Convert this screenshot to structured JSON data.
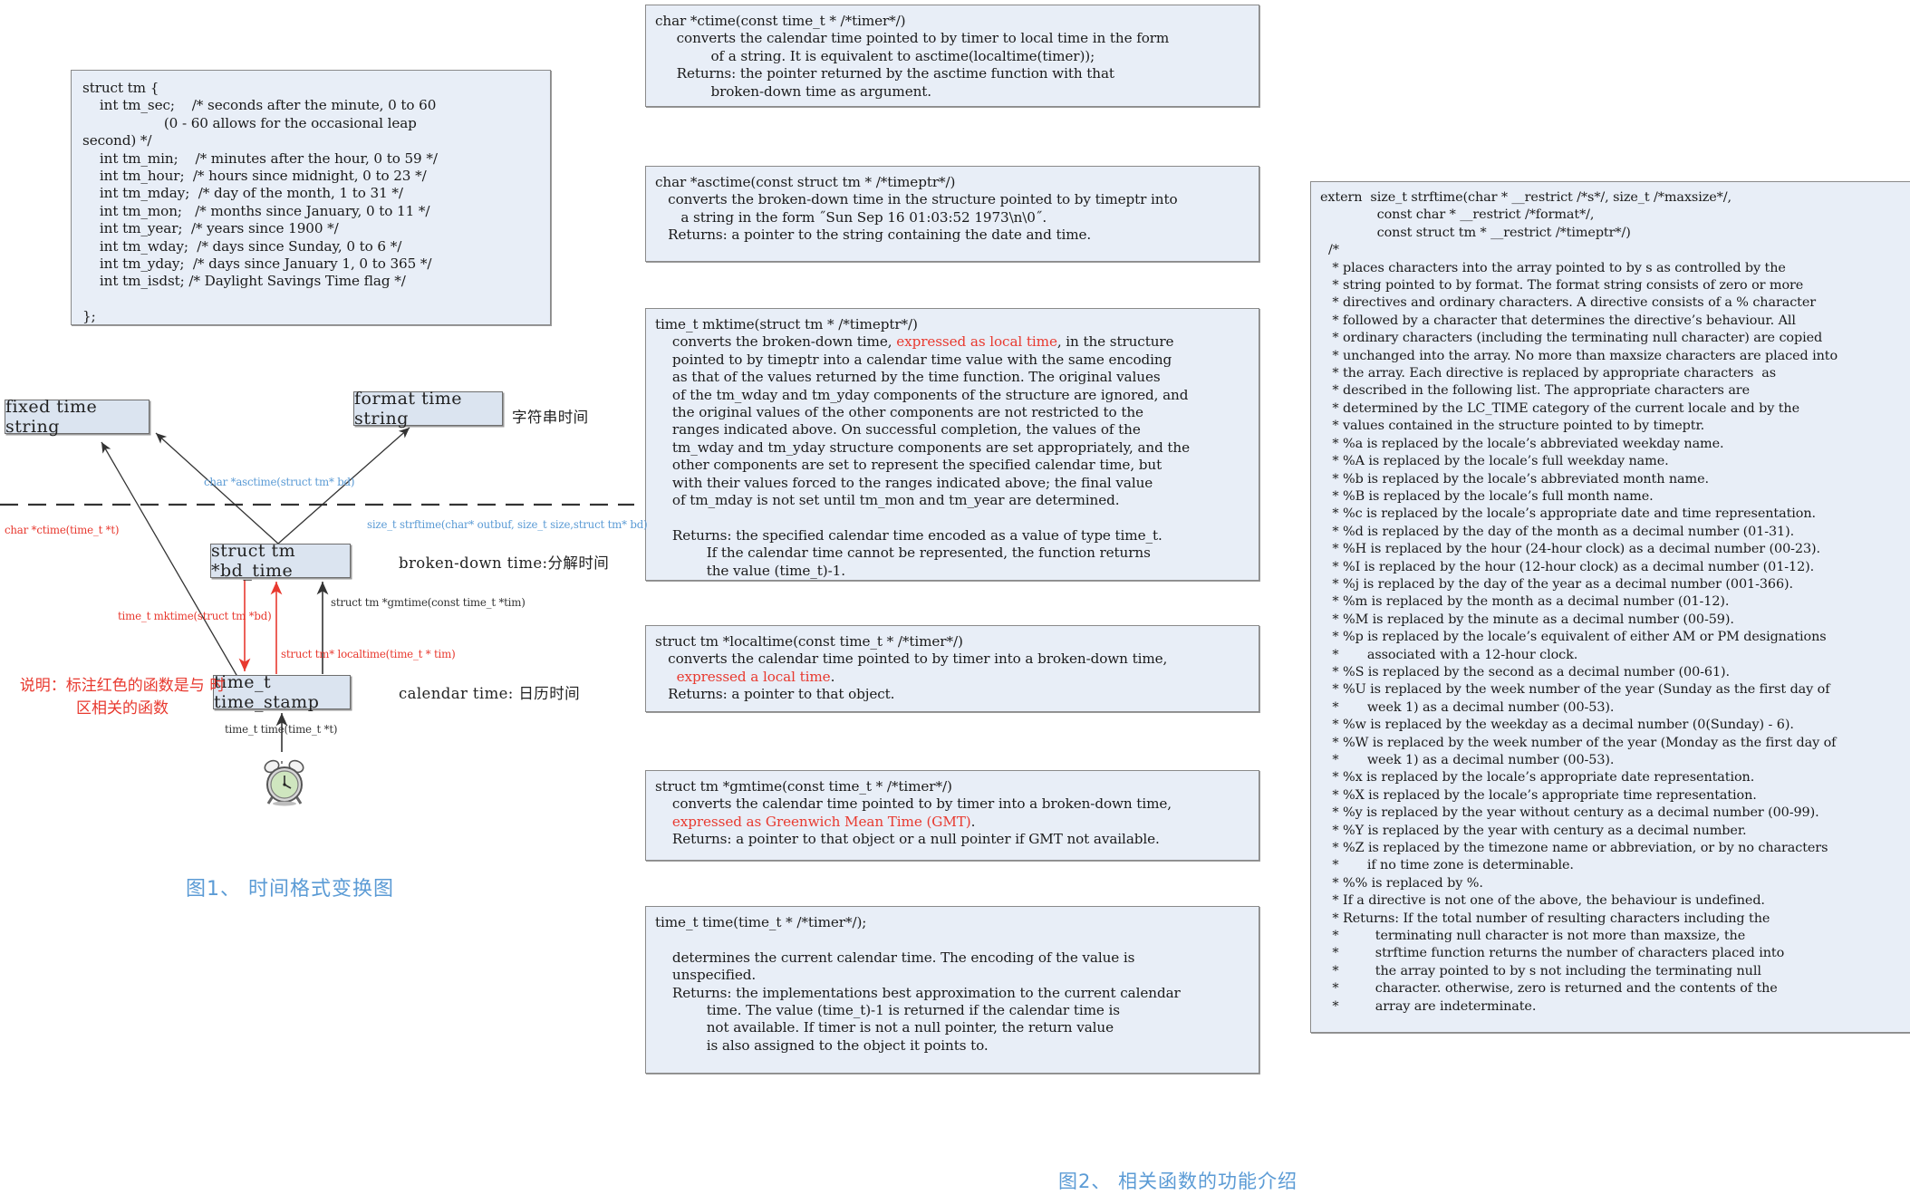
{
  "struct_box": {
    "code": "struct tm {\n    int tm_sec;    /* seconds after the minute, 0 to 60\n                   (0 - 60 allows for the occasional leap\nsecond) */\n    int tm_min;    /* minutes after the hour, 0 to 59 */\n    int tm_hour;  /* hours since midnight, 0 to 23 */\n    int tm_mday;  /* day of the month, 1 to 31 */\n    int tm_mon;   /* months since January, 0 to 11 */\n    int tm_year;  /* years since 1900 */\n    int tm_wday;  /* days since Sunday, 0 to 6 */\n    int tm_yday;  /* days since January 1, 0 to 365 */\n    int tm_isdst; /* Daylight Savings Time flag */\n\n};"
  },
  "middle_column": {
    "ctime": {
      "pre": "char *ctime(const time_t * /*timer*/)\n     converts the calendar time pointed to by timer to local time in the form\n             of a string. It is equivalent to asctime(localtime(timer));\n     Returns: the pointer returned by the asctime function with that\n             broken-down time as argument."
    },
    "asctime": {
      "pre": "char *asctime(const struct tm * /*timeptr*/)\n   converts the broken-down time in the structure pointed to by timeptr into\n      a string in the form ˝Sun Sep 16 01:03:52 1973\\n\\0˝.\n   Returns: a pointer to the string containing the date and time."
    },
    "mktime": {
      "line1": "time_t mktime(struct tm * /*timeptr*/)",
      "line2a": "    converts the broken-down time, ",
      "line2_red": "expressed as local time",
      "line2b": ", in the structure",
      "rest": "    pointed to by timeptr into a calendar time value with the same encoding\n    as that of the values returned by the time function. The original values\n    of the tm_wday and tm_yday components of the structure are ignored, and\n    the original values of the other components are not restricted to the\n    ranges indicated above. On successful completion, the values of the\n    tm_wday and tm_yday structure components are set appropriately, and the\n    other components are set to represent the specified calendar time, but\n    with their values forced to the ranges indicated above; the final value\n    of tm_mday is not set until tm_mon and tm_year are determined.\n\n    Returns: the specified calendar time encoded as a value of type time_t.\n            If the calendar time cannot be represented, the function returns\n            the value (time_t)-1."
    },
    "localtime": {
      "line1": "struct tm *localtime(const time_t * /*timer*/)",
      "line2": "   converts the calendar time pointed to by timer into a broken-down time,",
      "line3_red": "     expressed a local time",
      "line3b": ".",
      "line4": "   Returns: a pointer to that object."
    },
    "gmtime": {
      "line1": "struct tm *gmtime(const time_t * /*timer*/)",
      "line2": "    converts the calendar time pointed to by timer into a broken-down time,",
      "line3_red": "    expressed as Greenwich Mean Time (GMT)",
      "line3b": ".",
      "line4": "    Returns: a pointer to that object or a null pointer if GMT not available."
    },
    "time": {
      "pre": "time_t time(time_t * /*timer*/);\n\n    determines the current calendar time. The encoding of the value is\n    unspecified.\n    Returns: the implementations best approximation to the current calendar\n            time. The value (time_t)-1 is returned if the calendar time is\n            not available. If timer is not a null pointer, the return value\n            is also assigned to the object it points to."
    }
  },
  "right_column": {
    "strftime": {
      "pre": "extern  size_t strftime(char * __restrict /*s*/, size_t /*maxsize*/,\n              const char * __restrict /*format*/,\n              const struct tm * __restrict /*timeptr*/)\n  /*\n   * places characters into the array pointed to by s as controlled by the\n   * string pointed to by format. The format string consists of zero or more\n   * directives and ordinary characters. A directive consists of a % character\n   * followed by a character that determines the directive’s behaviour. All\n   * ordinary characters (including the terminating null character) are copied\n   * unchanged into the array. No more than maxsize characters are placed into\n   * the array. Each directive is replaced by appropriate characters  as\n   * described in the following list. The appropriate characters are\n   * determined by the LC_TIME category of the current locale and by the\n   * values contained in the structure pointed to by timeptr.\n   * %a is replaced by the locale’s abbreviated weekday name.\n   * %A is replaced by the locale’s full weekday name.\n   * %b is replaced by the locale’s abbreviated month name.\n   * %B is replaced by the locale’s full month name.\n   * %c is replaced by the locale’s appropriate date and time representation.\n   * %d is replaced by the day of the month as a decimal number (01-31).\n   * %H is replaced by the hour (24-hour clock) as a decimal number (00-23).\n   * %I is replaced by the hour (12-hour clock) as a decimal number (01-12).\n   * %j is replaced by the day of the year as a decimal number (001-366).\n   * %m is replaced by the month as a decimal number (01-12).\n   * %M is replaced by the minute as a decimal number (00-59).\n   * %p is replaced by the locale’s equivalent of either AM or PM designations\n   *       associated with a 12-hour clock.\n   * %S is replaced by the second as a decimal number (00-61).\n   * %U is replaced by the week number of the year (Sunday as the first day of\n   *       week 1) as a decimal number (00-53).\n   * %w is replaced by the weekday as a decimal number (0(Sunday) - 6).\n   * %W is replaced by the week number of the year (Monday as the first day of\n   *       week 1) as a decimal number (00-53).\n   * %x is replaced by the locale’s appropriate date representation.\n   * %X is replaced by the locale’s appropriate time representation.\n   * %y is replaced by the year without century as a decimal number (00-99).\n   * %Y is replaced by the year with century as a decimal number.\n   * %Z is replaced by the timezone name or abbreviation, or by no characters\n   *       if no time zone is determinable.\n   * %% is replaced by %.\n   * If a directive is not one of the above, the behaviour is undefined.\n   * Returns: If the total number of resulting characters including the\n   *         terminating null character is not more than maxsize, the\n   *         strftime function returns the number of characters placed into\n   *         the array pointed to by s not including the terminating null\n   *         character. otherwise, zero is returned and the contents of the\n   *         array are indeterminate."
    }
  },
  "diagram": {
    "nodes": {
      "fixed_time_string": "fixed time string",
      "format_time_string": "format time string",
      "bd_time": "struct tm *bd_time",
      "time_stamp": "time_t time_stamp"
    },
    "side_labels": {
      "string_time": "字符串时间",
      "broken_down": "broken-down time:分解时间",
      "calendar": "calendar time: 日历时间"
    },
    "arrow_labels": {
      "asctime": "char *asctime(struct tm* bd)",
      "strftime": "size_t strftime(char* outbuf, size_t size,struct tm* bd)",
      "ctime": "char *ctime(time_t *t)",
      "mktime": "time_t mktime(struct tm *bd)",
      "localtime": "struct tm* localtime(time_t * tim)",
      "gmtime": "struct tm *gmtime(const time_t *tim)",
      "time": "time_t time(time_t *t)"
    },
    "note": "说明：标注红色的函数是与\n时区相关的函数",
    "colors": {
      "box_fill": "#dbe4f0",
      "code_fill": "#e8eef7",
      "accent_blue": "#5b9bd5",
      "accent_red": "#e8392f"
    }
  },
  "captions": {
    "fig1": "图1、 时间格式变换图",
    "fig2": "图2、 相关函数的功能介绍"
  }
}
